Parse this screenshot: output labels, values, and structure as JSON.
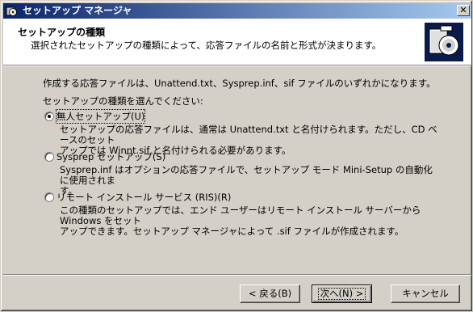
{
  "window": {
    "title": "セットアップ マネージャ",
    "close_glyph": "✕"
  },
  "header": {
    "title": "セットアップの種類",
    "subtitle": "選択されたセットアップの種類によって、応答ファイルの名前と形式が決まります。"
  },
  "content": {
    "intro": "作成する応答ファイルは、Unattend.txt、Sysprep.inf、sif ファイルのいずれかになります。",
    "prompt": "セットアップの種類を選んでください:",
    "options": [
      {
        "label": "無人セットアップ(U)",
        "checked": true,
        "desc_line1": "セットアップの応答ファイルは、通常は Unattend.txt と名付けられます。ただし、CD ベースのセット",
        "desc_line2": "アップでは Winnt.sif と名付けられる必要があります。"
      },
      {
        "label": "Sysprep セットアップ(S)",
        "checked": false,
        "desc_line1": "Sysprep.inf はオプションの応答ファイルで、セットアップ モード Mini-Setup の自動化に使用されま",
        "desc_line2": "す。"
      },
      {
        "label": "リモート インストール サービス (RIS)(R)",
        "checked": false,
        "desc_line1": "この種類のセットアップでは、エンド ユーザーはリモート インストール サーバーから Windows をセット",
        "desc_line2": "アップできます。セットアップ マネージャによって .sif ファイルが作成されます。"
      }
    ]
  },
  "buttons": {
    "back": "< 戻る(B)",
    "next": "次へ(N) >",
    "cancel": "キャンセル"
  },
  "icons": {
    "app": "setup-manager-icon",
    "header": "box-cd-icon"
  }
}
